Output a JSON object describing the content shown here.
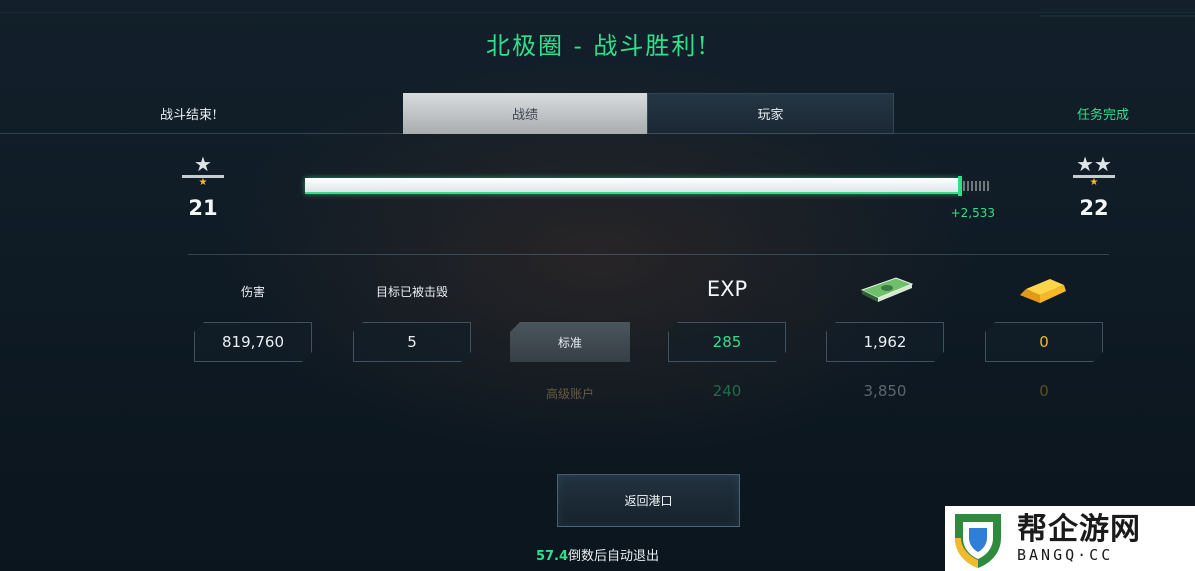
{
  "header": {
    "title": "北极圈 - 战斗胜利!",
    "battle_over": "战斗结束!",
    "mission_complete": "任务完成"
  },
  "tabs": [
    {
      "label": "战绩",
      "active": true
    },
    {
      "label": "玩家",
      "active": false
    }
  ],
  "progress": {
    "current_level": "21",
    "next_level": "22",
    "xp_gain": "+2,533",
    "fill_fraction": 0.955
  },
  "stats": {
    "damage_label": "伤害",
    "damage_value": "819,760",
    "destroyed_label": "目标已被击毁",
    "destroyed_value": "5"
  },
  "rewards": {
    "exp_label": "EXP",
    "cash_icon": "money-stack-icon",
    "gold_icon": "gold-bar-icon",
    "standard_label": "标准",
    "standard_exp": "285",
    "standard_cash": "1,962",
    "standard_gold": "0",
    "premium_label": "高级账户",
    "premium_exp": "240",
    "premium_cash": "3,850",
    "premium_gold": "0"
  },
  "footer": {
    "return_button": "返回港口",
    "countdown_value": "57.4",
    "countdown_text": "倒数后自动退出"
  },
  "watermark": {
    "cn": "帮企游网",
    "en": "BANGQ·CC"
  },
  "colors": {
    "accent_green": "#2fe08a",
    "gold": "#f2b92b",
    "premium_label": "#6a5a40"
  }
}
